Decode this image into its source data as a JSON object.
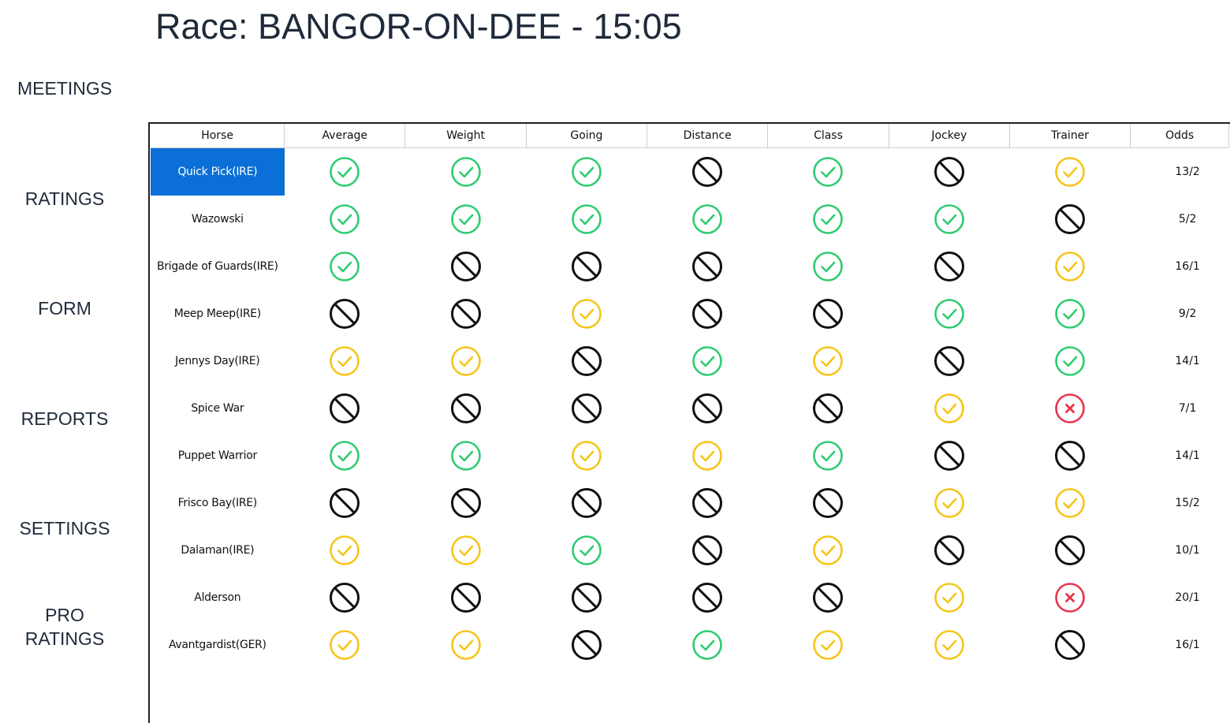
{
  "title": "Race: BANGOR-ON-DEE - 15:05",
  "nav": [
    "MEETINGS",
    "RATINGS",
    "FORM",
    "REPORTS",
    "SETTINGS",
    "PRO\nRATINGS"
  ],
  "columns": [
    "Horse",
    "Average",
    "Weight",
    "Going",
    "Distance",
    "Class",
    "Jockey",
    "Trainer",
    "Odds"
  ],
  "selected_row": 0,
  "colors": {
    "good": "#2ecc71",
    "medium": "#f5c518",
    "bad": "#e8344e",
    "none": "#111111",
    "selected_bg": "#0a6fd6"
  },
  "status_legend": {
    "good": "green-check-icon",
    "medium": "yellow-check-icon",
    "bad": "red-x-icon",
    "none": "no-data-icon"
  },
  "rows": [
    {
      "horse": "Quick Pick(IRE)",
      "ratings": [
        "good",
        "good",
        "good",
        "none",
        "good",
        "none",
        "medium"
      ],
      "odds": "13/2"
    },
    {
      "horse": "Wazowski",
      "ratings": [
        "good",
        "good",
        "good",
        "good",
        "good",
        "good",
        "none"
      ],
      "odds": "5/2"
    },
    {
      "horse": "Brigade of Guards(IRE)",
      "ratings": [
        "good",
        "none",
        "none",
        "none",
        "good",
        "none",
        "medium"
      ],
      "odds": "16/1"
    },
    {
      "horse": "Meep Meep(IRE)",
      "ratings": [
        "none",
        "none",
        "medium",
        "none",
        "none",
        "good",
        "good"
      ],
      "odds": "9/2"
    },
    {
      "horse": "Jennys Day(IRE)",
      "ratings": [
        "medium",
        "medium",
        "none",
        "good",
        "medium",
        "none",
        "good"
      ],
      "odds": "14/1"
    },
    {
      "horse": "Spice War",
      "ratings": [
        "none",
        "none",
        "none",
        "none",
        "none",
        "medium",
        "bad"
      ],
      "odds": "7/1"
    },
    {
      "horse": "Puppet Warrior",
      "ratings": [
        "good",
        "good",
        "medium",
        "medium",
        "good",
        "none",
        "none"
      ],
      "odds": "14/1"
    },
    {
      "horse": "Frisco Bay(IRE)",
      "ratings": [
        "none",
        "none",
        "none",
        "none",
        "none",
        "medium",
        "medium"
      ],
      "odds": "15/2"
    },
    {
      "horse": "Dalaman(IRE)",
      "ratings": [
        "medium",
        "medium",
        "good",
        "none",
        "medium",
        "none",
        "none"
      ],
      "odds": "10/1"
    },
    {
      "horse": "Alderson",
      "ratings": [
        "none",
        "none",
        "none",
        "none",
        "none",
        "medium",
        "bad"
      ],
      "odds": "20/1"
    },
    {
      "horse": "Avantgardist(GER)",
      "ratings": [
        "medium",
        "medium",
        "none",
        "good",
        "medium",
        "medium",
        "none"
      ],
      "odds": "16/1"
    }
  ]
}
